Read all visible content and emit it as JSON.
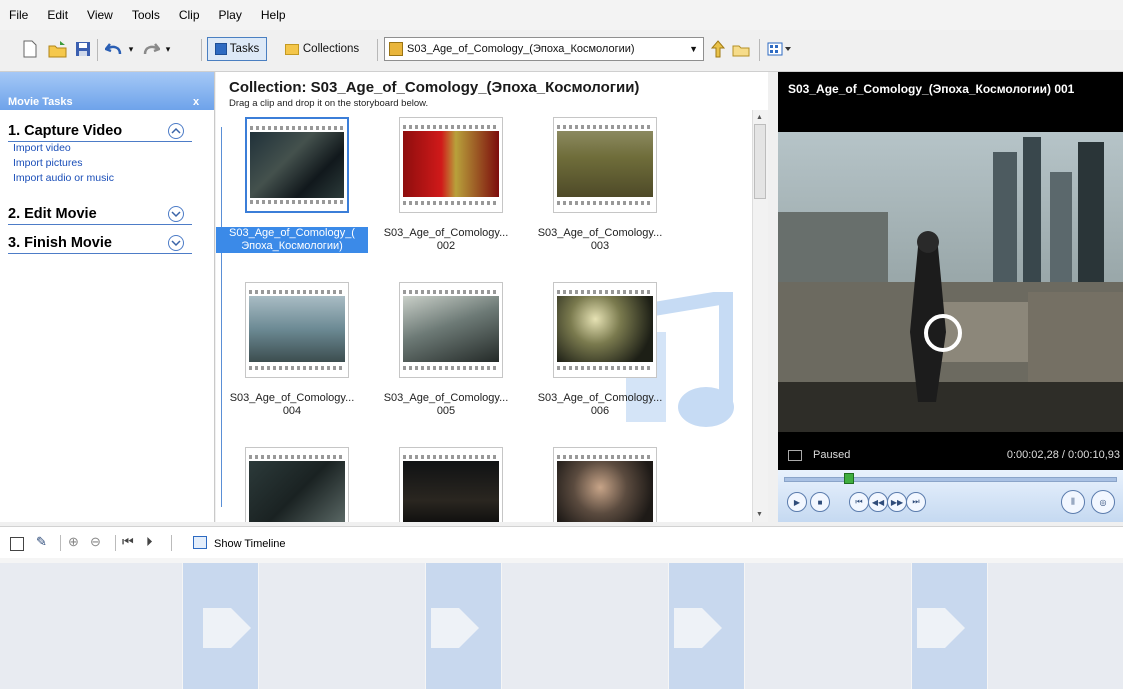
{
  "menu": [
    "File",
    "Edit",
    "View",
    "Tools",
    "Clip",
    "Play",
    "Help"
  ],
  "toolbar": {
    "tasks_label": "Tasks",
    "collections_label": "Collections",
    "collection_value": "S03_Age_of_Comology_(Эпоха_Космологии)"
  },
  "task_pane": {
    "title": "Movie Tasks",
    "close": "x",
    "sections": [
      {
        "label": "1. Capture Video",
        "links": [
          "Import video",
          "Import pictures",
          "Import audio or music"
        ]
      },
      {
        "label": "2. Edit Movie",
        "links": []
      },
      {
        "label": "3. Finish Movie",
        "links": []
      }
    ]
  },
  "collection": {
    "title": "Collection: S03_Age_of_Comology_(Эпоха_Космологии)",
    "hint": "Drag a clip and drop it on the storyboard below.",
    "clips": [
      {
        "line1": "S03_Age_of_Comology_(",
        "line2": "Эпоха_Космологии)",
        "selected": true
      },
      {
        "line1": "S03_Age_of_Comology...",
        "line2": "002",
        "selected": false
      },
      {
        "line1": "S03_Age_of_Comology...",
        "line2": "003",
        "selected": false
      },
      {
        "line1": "S03_Age_of_Comology...",
        "line2": "004",
        "selected": false
      },
      {
        "line1": "S03_Age_of_Comology...",
        "line2": "005",
        "selected": false
      },
      {
        "line1": "S03_Age_of_Comology...",
        "line2": "006",
        "selected": false
      },
      {
        "line1": "",
        "line2": "",
        "selected": false
      },
      {
        "line1": "",
        "line2": "",
        "selected": false
      },
      {
        "line1": "",
        "line2": "",
        "selected": false
      }
    ]
  },
  "preview": {
    "title": "S03_Age_of_Comology_(Эпоха_Космологии) 001",
    "status": "Paused",
    "time": "0:00:02,28 / 0:00:10,93"
  },
  "storyboard": {
    "show_timeline_label": "Show Timeline"
  },
  "colors": {
    "accent": "#3b8ae8",
    "task_header": "#6ea3ea",
    "link": "#1a4eb8"
  }
}
